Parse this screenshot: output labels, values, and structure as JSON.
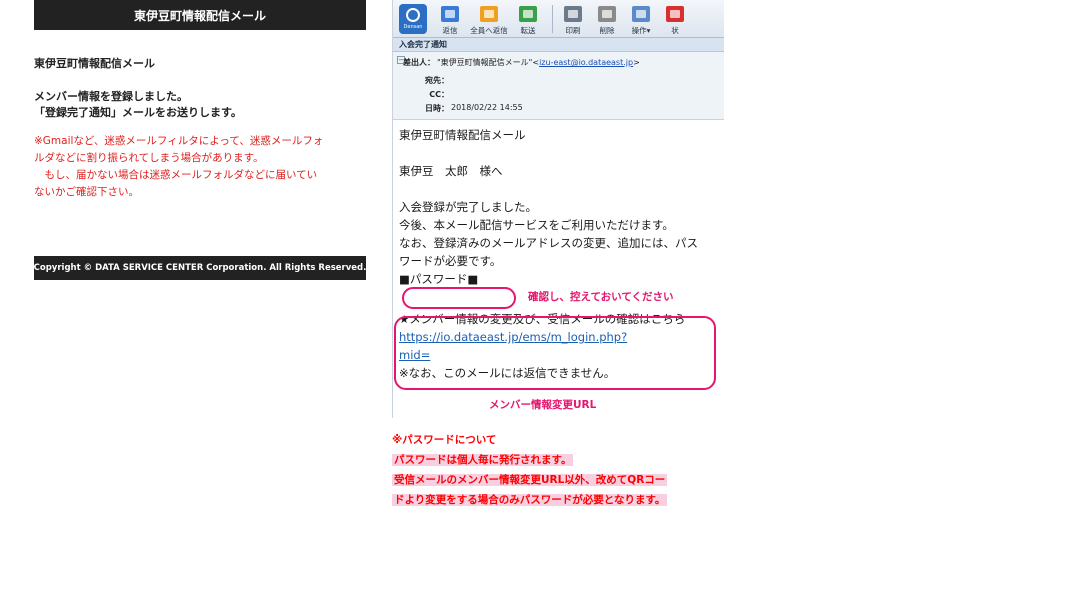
{
  "registration": {
    "header_title": "東伊豆町情報配信メール",
    "site_name": "東伊豆町情報配信メール",
    "message_lines": [
      "メンバー情報を登録しました。",
      "「登録完了通知」メールをお送りします。"
    ],
    "note_lines": [
      "※Gmailなど、迷惑メールフィルタによって、迷惑メールフォ",
      "ルダなどに割り振られてしまう場合があります。",
      "　もし、届かない場合は迷惑メールフォルダなどに届いてい",
      "ないかご確認下さい。"
    ],
    "footer": "Copyright © DATA SERVICE CENTER Corporation. All Rights Reserved."
  },
  "mail_client": {
    "logo_word": "Densan",
    "toolbar": [
      {
        "label": "返信",
        "icon": "reply-icon",
        "color": "#3a7bd5"
      },
      {
        "label": "全員へ返信",
        "icon": "reply-all-icon",
        "color": "#f0a020"
      },
      {
        "label": "転送",
        "icon": "forward-icon",
        "color": "#3aa04a"
      },
      {
        "label": "印刷",
        "icon": "print-icon",
        "color": "#6b7b8c"
      },
      {
        "label": "削除",
        "icon": "trash-icon",
        "color": "#8a8a8a"
      },
      {
        "label": "操作▾",
        "icon": "operations-icon",
        "color": "#5a8ac8"
      },
      {
        "label": "状",
        "icon": "status-icon",
        "color": "#d83030"
      }
    ],
    "subject": "入会完了通知",
    "headers": {
      "from_label": "差出人：",
      "from_name": "\"東伊豆町情報配信メール\"<",
      "from_address": "izu-east@io.dataeast.jp",
      "from_suffix": ">",
      "to_label": "宛先：",
      "cc_label": "CC：",
      "date_label": "日時：",
      "date_value": "2018/02/22 14:55"
    },
    "body": {
      "line1": "東伊豆町情報配信メール",
      "line2": "東伊豆　太郎　様へ",
      "line3": "入会登録が完了しました。",
      "line4": "今後、本メール配信サービスをご利用いただけます。",
      "line5": "なお、登録済みのメールアドレスの変更、追加には、パス",
      "line6": "ワードが必要です。",
      "line7": "■パスワード■",
      "line8": "★メンバー情報の変更及び、受信メールの確認はこちら",
      "link1": "https://io.dataeast.jp/ems/m_login.php?",
      "link2": "mid=",
      "line9": "※なお、このメールには返信できません。"
    }
  },
  "annotations": {
    "password_note": "確認し、控えておいてください",
    "url_note": "メンバー情報変更URL",
    "accent": "#e5166d"
  },
  "password_info": [
    "※パスワードについて",
    "パスワードは個人毎に発行されます。",
    "受信メールのメンバー情報変更URL以外、改めてQRコー",
    "ドより変更をする場合のみパスワードが必要となります。"
  ]
}
